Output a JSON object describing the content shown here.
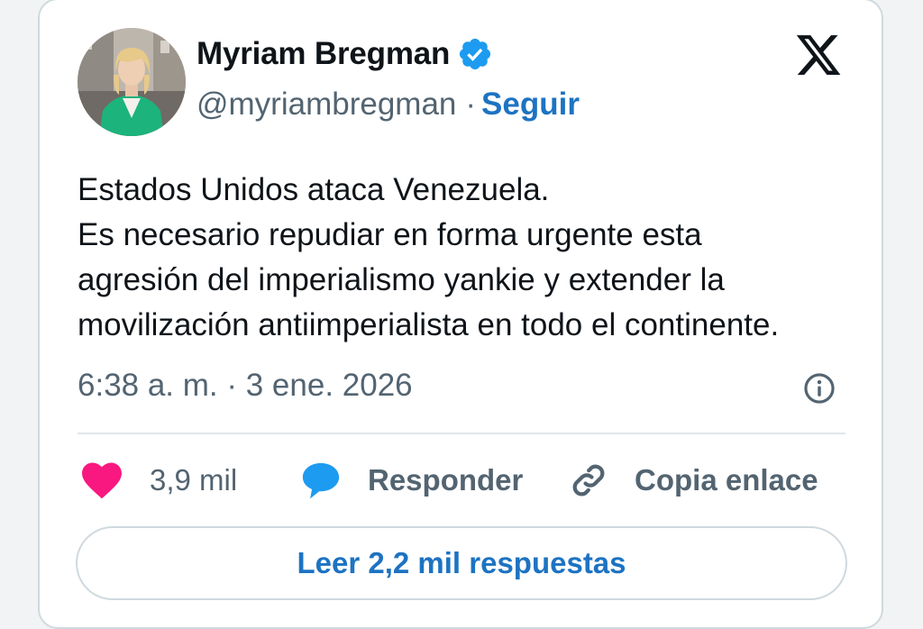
{
  "author": {
    "name": "Myriam Bregman",
    "handle": "@myriambregman",
    "separator": "·",
    "follow_label": "Seguir"
  },
  "icons": {
    "verified": "verified-badge-icon",
    "brand": "x-logo-icon",
    "info": "info-icon",
    "like": "heart-icon",
    "reply": "speech-bubble-icon",
    "copy": "link-icon"
  },
  "tweet": {
    "lines": [
      "Estados Unidos ataca Venezuela.",
      "Es necesario repudiar en forma urgente esta",
      "agresión del imperialismo yankie y extender la",
      "movilización antiimperialista en todo el continente."
    ],
    "timestamp": "6:38 a. m. · 3 ene. 2026"
  },
  "actions": {
    "likes": "3,9 mil",
    "reply_label": "Responder",
    "copy_label": "Copia enlace"
  },
  "read_replies_label": "Leer 2,2 mil respuestas",
  "colors": {
    "link_blue": "#1d73c2",
    "verified_blue": "#1d9bf0",
    "heart_pink": "#f91880",
    "secondary_text": "#536471",
    "primary_text": "#0f1419",
    "border": "#cfd9de"
  }
}
